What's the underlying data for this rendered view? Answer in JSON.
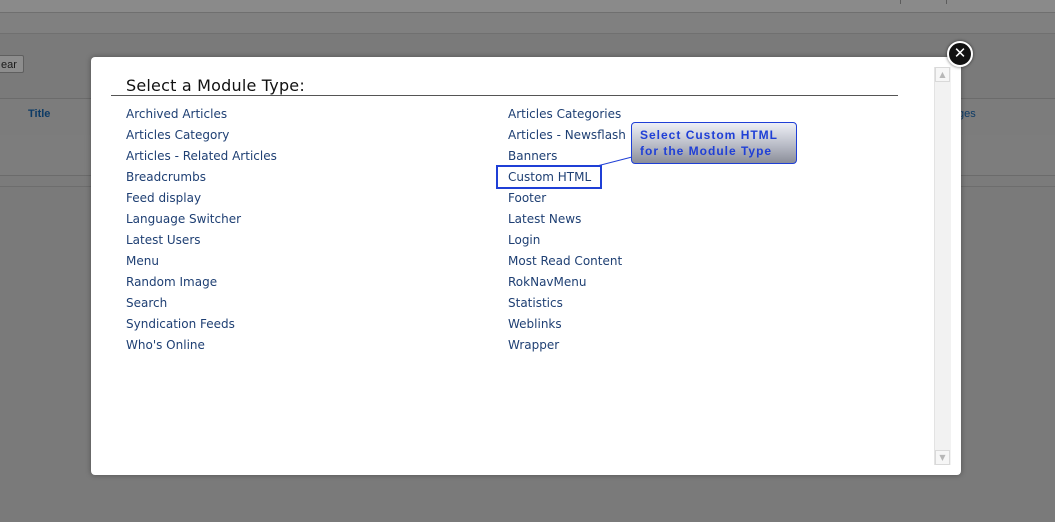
{
  "background": {
    "clear_button": "ear",
    "title_header": "Title",
    "pages_header": "ges"
  },
  "modal": {
    "title": "Select a Module Type:",
    "close_glyph": "✕",
    "left_column": [
      "Archived Articles",
      "Articles Category",
      "Articles - Related Articles",
      "Breadcrumbs",
      "Feed display",
      "Language Switcher",
      "Latest Users",
      "Menu",
      "Random Image",
      "Search",
      "Syndication Feeds",
      "Who's Online"
    ],
    "right_column": [
      "Articles Categories",
      "Articles - Newsflash",
      "Banners",
      "Custom HTML",
      "Footer",
      "Latest News",
      "Login",
      "Most Read Content",
      "RokNavMenu",
      "Statistics",
      "Weblinks",
      "Wrapper"
    ],
    "highlighted_item": "Custom HTML"
  },
  "scrollbar": {
    "up_glyph": "▲",
    "down_glyph": "▼"
  },
  "annotation": {
    "line1": "Select Custom HTML",
    "line2": "for the Module Type",
    "color": "#1f3fd6"
  }
}
